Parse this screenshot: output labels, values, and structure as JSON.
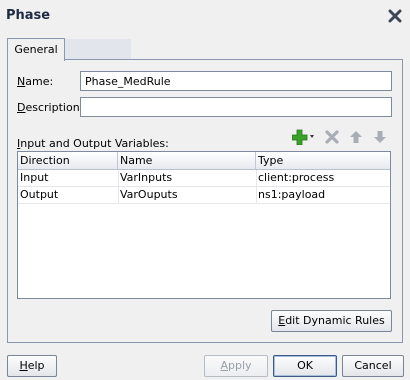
{
  "window": {
    "title": "Phase"
  },
  "tabs": [
    {
      "label": "General"
    }
  ],
  "form": {
    "name_label": "Name:",
    "name_value": "Phase_MedRule",
    "description_label": "Description:",
    "description_value": ""
  },
  "variables": {
    "section_label": "Input and Output Variables:",
    "columns": [
      "Direction",
      "Name",
      "Type"
    ],
    "rows": [
      {
        "direction": "Input",
        "name": "VarInputs",
        "type": "client:process"
      },
      {
        "direction": "Output",
        "name": "VarOuputs",
        "type": "ns1:payload"
      }
    ],
    "toolbar_icons": [
      "add-icon",
      "delete-icon",
      "move-up-icon",
      "move-down-icon"
    ]
  },
  "buttons": {
    "edit_dynamic_rules": "Edit Dynamic Rules",
    "help": "Help",
    "apply": "Apply",
    "ok": "OK",
    "cancel": "Cancel"
  },
  "colors": {
    "add_icon": "#3aa12a",
    "disabled_icon": "#a9aeb6",
    "title_text": "#1f2a44"
  }
}
